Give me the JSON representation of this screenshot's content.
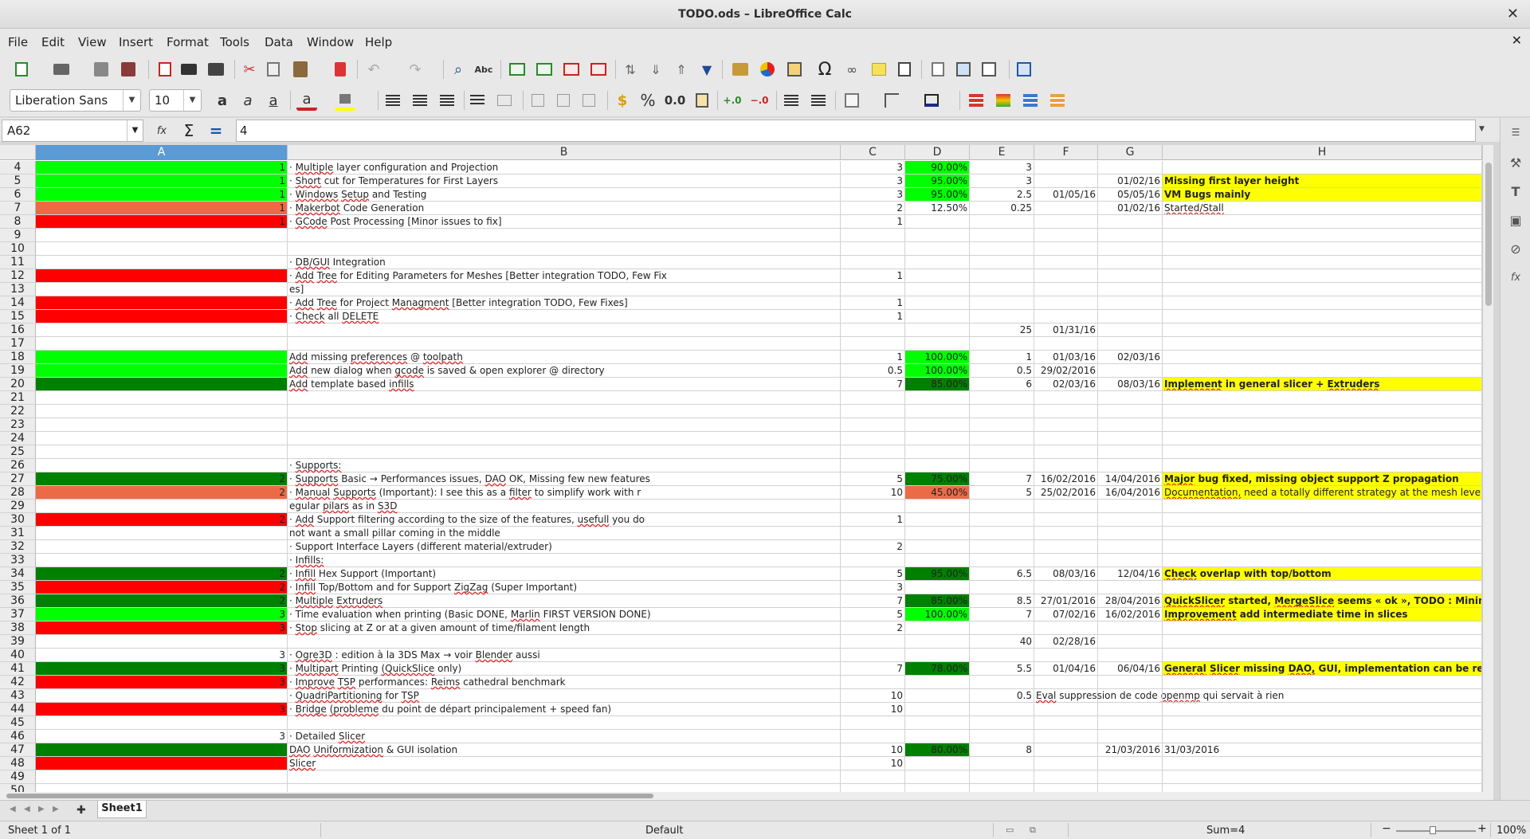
{
  "window": {
    "title": "TODO.ods – LibreOffice Calc"
  },
  "menu": [
    "File",
    "Edit",
    "View",
    "Insert",
    "Format",
    "Tools",
    "Data",
    "Window",
    "Help"
  ],
  "font": {
    "name": "Liberation Sans",
    "size": "10"
  },
  "formula": {
    "cell_ref": "A62",
    "value": "4"
  },
  "columns": [
    "A",
    "B",
    "C",
    "D",
    "E",
    "F",
    "G",
    "H"
  ],
  "colors": {
    "green": "#00ff00",
    "darkgreen": "#008000",
    "orange": "#ec6b46",
    "red": "#ff0000",
    "yellow": "#ffff00",
    "selected_header": "#5a9bd6"
  },
  "rows": [
    {
      "n": "4",
      "a": "1",
      "afill": "green",
      "b": "· Multiple layer configuration and Projection",
      "c": "3",
      "d": "90.00%",
      "dfill": "green",
      "e": "3"
    },
    {
      "n": "5",
      "a": "1",
      "afill": "green",
      "b": "· Short cut for Temperatures for First Layers",
      "c": "3",
      "d": "95.00%",
      "dfill": "green",
      "e": "3",
      "g": "01/02/16",
      "h": "Missing first layer height",
      "hfill": "yellow",
      "hbold": true
    },
    {
      "n": "6",
      "a": "1",
      "afill": "green",
      "b": "· Windows Setup and Testing",
      "c": "3",
      "d": "95.00%",
      "dfill": "green",
      "e": "2.5",
      "f": "01/05/16",
      "g": "05/05/16",
      "h": "VM Bugs mainly",
      "hfill": "yellow",
      "hbold": true
    },
    {
      "n": "7",
      "a": "1",
      "afill": "orange",
      "b": "· Makerbot Code Generation",
      "c": "2",
      "d": "12.50%",
      "e": "0.25",
      "g": "01/02/16",
      "h": "Started/Stall"
    },
    {
      "n": "8",
      "a": "1",
      "afill": "red",
      "b": "· GCode Post Processing [Minor issues to fix]",
      "c": "1"
    },
    {
      "n": "9"
    },
    {
      "n": "10"
    },
    {
      "n": "11",
      "b": "· DB/GUI Integration"
    },
    {
      "n": "12",
      "afill": "red",
      "b": "  · Add Tree for Editing Parameters for Meshes [Better integration TODO, Few Fix",
      "c": "1"
    },
    {
      "n": "13",
      "b": "es]"
    },
    {
      "n": "14",
      "afill": "red",
      "b": "  · Add Tree for Project Managment [Better integration TODO, Few Fixes]",
      "c": "1"
    },
    {
      "n": "15",
      "afill": "red",
      "b": "  · Check all DELETE",
      "c": "1"
    },
    {
      "n": "16",
      "e": "25",
      "f": "01/31/16"
    },
    {
      "n": "17"
    },
    {
      "n": "18",
      "afill": "green",
      "b": "Add missing preferences @ toolpath",
      "c": "1",
      "d": "100.00%",
      "dfill": "green",
      "e": "1",
      "f": "01/03/16",
      "g": "02/03/16"
    },
    {
      "n": "19",
      "afill": "green",
      "b": "Add new dialog when gcode is saved & open explorer @ directory",
      "c": "0.5",
      "d": "100.00%",
      "dfill": "green",
      "e": "0.5",
      "f": "29/02/2016"
    },
    {
      "n": "20",
      "afill": "darkgreen",
      "b": "Add template based infills",
      "c": "7",
      "d": "85.00%",
      "dfill": "darkgreen",
      "e": "6",
      "f": "02/03/16",
      "g": "08/03/16",
      "h": "Implement in general slicer + Extruders",
      "hfill": "yellow",
      "hbold": true
    },
    {
      "n": "21"
    },
    {
      "n": "22"
    },
    {
      "n": "23"
    },
    {
      "n": "24"
    },
    {
      "n": "25"
    },
    {
      "n": "26",
      "b": "· Supports:"
    },
    {
      "n": "27",
      "a": "2",
      "afill": "darkgreen",
      "b": "  · Supports Basic → Performances issues, DAO OK, Missing few new features",
      "c": "5",
      "d": "75.00%",
      "dfill": "darkgreen",
      "e": "7",
      "f": "16/02/2016",
      "g": "14/04/2016",
      "h": "Major bug fixed, missing object support Z propagation",
      "hfill": "yellow",
      "hbold": true
    },
    {
      "n": "28",
      "a": "2",
      "afill": "orange",
      "b": "  · Manual Supports (Important): I see this as a filter to simplify work with r",
      "c": "10",
      "d": "45.00%",
      "dfill": "orange",
      "e": "5",
      "f": "25/02/2016",
      "g": "16/04/2016",
      "h": "Documentation, need a totally different strategy at the mesh level, sta",
      "hfill": "yellow"
    },
    {
      "n": "29",
      "b": "egular pilars as in S3D"
    },
    {
      "n": "30",
      "a": "2",
      "afill": "red",
      "b": "  · Add Support filtering according to the size of the features, usefull you do",
      "c": "1"
    },
    {
      "n": "31",
      "b": " not want a small pillar coming in the middle"
    },
    {
      "n": "32",
      "b": "  · Support Interface Layers (different material/extruder)",
      "c": "2"
    },
    {
      "n": "33",
      "b": "· Infills:"
    },
    {
      "n": "34",
      "a": "2",
      "afill": "darkgreen",
      "b": "  · Infill Hex Support (Important)",
      "c": "5",
      "d": "95.00%",
      "dfill": "darkgreen",
      "e": "6.5",
      "f": "08/03/16",
      "g": "12/04/16",
      "h": "Check overlap with top/bottom",
      "hfill": "yellow",
      "hbold": true
    },
    {
      "n": "35",
      "a": "2",
      "afill": "red",
      "b": "  · Infill Top/Bottom and for Support ZigZag (Super Important)",
      "c": "3"
    },
    {
      "n": "36",
      "a": "2",
      "afill": "darkgreen",
      "b": "· Multiple Extruders",
      "c": "7",
      "d": "85.00%",
      "dfill": "darkgreen",
      "e": "8.5",
      "f": "27/01/2016",
      "g": "28/04/2016",
      "h": "QuickSlicer started, MergeSlice seems « ok », TODO : Minimize",
      "hfill": "yellow",
      "hbold": true
    },
    {
      "n": "37",
      "a": "3",
      "afill": "green",
      "b": "· Time evaluation when printing (Basic DONE, Marlin FIRST VERSION DONE)",
      "c": "5",
      "d": "100.00%",
      "dfill": "green",
      "e": "7",
      "f": "07/02/16",
      "g": "16/02/2016",
      "h": "Improvement add intermediate time in slices",
      "hfill": "yellow",
      "hbold": true
    },
    {
      "n": "38",
      "a": "3",
      "afill": "red",
      "b": "· Stop slicing at Z or at a given amount of time/filament length",
      "c": "2"
    },
    {
      "n": "39",
      "e": "40",
      "f": "02/28/16"
    },
    {
      "n": "40",
      "a": "3",
      "b": "  · Ogre3D : edition à la 3DS Max → voir Blender aussi"
    },
    {
      "n": "41",
      "a": "3",
      "afill": "darkgreen",
      "b": "· Multipart Printing (QuickSlice only)",
      "c": "7",
      "d": "78.00%",
      "dfill": "darkgreen",
      "e": "5.5",
      "f": "01/04/16",
      "g": "06/04/16",
      "h": "General Slicer missing DAO, GUI, implementation can be reuse",
      "hfill": "yellow",
      "hbold": true
    },
    {
      "n": "42",
      "a": "3",
      "afill": "red",
      "b": "· Improve TSP performances: Reims cathedral benchmark"
    },
    {
      "n": "43",
      "b": "  · QuadriPartitioning for TSP",
      "c": "10",
      "e": "0.5",
      "f": "Eval suppression de code openmp qui servait à rien"
    },
    {
      "n": "44",
      "a": "3",
      "afill": "red",
      "b": "· Bridge (probleme du point de départ principalement + speed fan)",
      "c": "10"
    },
    {
      "n": "45"
    },
    {
      "n": "46",
      "a": "3",
      "b": "· Detailed Slicer"
    },
    {
      "n": "47",
      "afill": "darkgreen",
      "b": "DAO Uniformization & GUI isolation",
      "c": "10",
      "d": "80.00%",
      "dfill": "darkgreen",
      "e": "8",
      "g": "21/03/2016",
      "h": "31/03/2016"
    },
    {
      "n": "48",
      "afill": "red",
      "b": "Slicer",
      "c": "10"
    },
    {
      "n": "49"
    },
    {
      "n": "50"
    }
  ],
  "sheet": {
    "tab": "Sheet1"
  },
  "status": {
    "sheet_info": "Sheet 1 of 1",
    "style": "Default",
    "sum": "Sum=4",
    "zoom": "100%"
  }
}
